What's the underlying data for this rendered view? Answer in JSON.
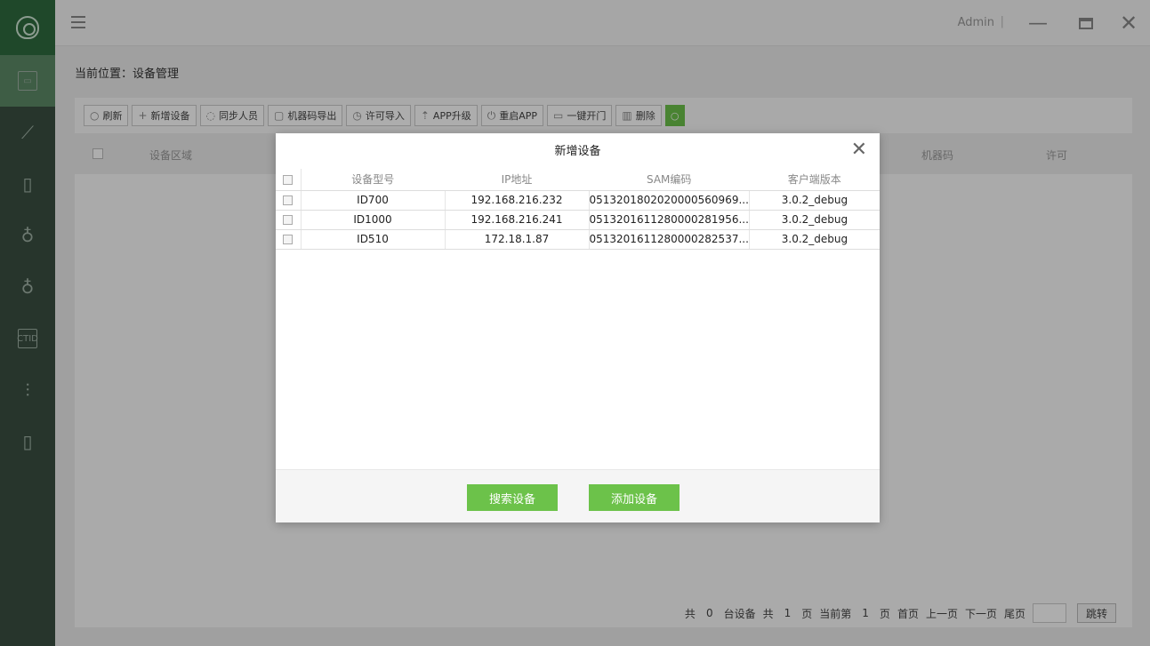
{
  "topbar": {
    "user": "Admin",
    "separator": "|"
  },
  "breadcrumb": "当前位置：设备管理",
  "toolbar": {
    "refresh": "刷新",
    "add_device": "新增设备",
    "sync_people": "同步人员",
    "export_machine_code": "机器码导出",
    "import_license": "许可导入",
    "app_upgrade": "APP升级",
    "restart_app": "重启APP",
    "one_key_open": "一键开门",
    "delete": "删除"
  },
  "main_table": {
    "columns": [
      "设备区域",
      "机器码",
      "许可"
    ]
  },
  "pagination": {
    "total_label": "共",
    "total_count": "0",
    "unit_devices": "台设备",
    "pages_label": "共",
    "pages_count": "1",
    "page_unit": "页",
    "current_label": "当前第",
    "current_page": "1",
    "current_unit": "页",
    "first": "首页",
    "prev": "上一页",
    "next": "下一页",
    "last": "尾页",
    "jump": "跳转"
  },
  "modal": {
    "title": "新增设备",
    "columns": [
      "设备型号",
      "IP地址",
      "SAM编码",
      "客户端版本"
    ],
    "rows": [
      {
        "model": "ID700",
        "ip": "192.168.216.232",
        "sam": "0513201802020000560969...",
        "version": "3.0.2_debug"
      },
      {
        "model": "ID1000",
        "ip": "192.168.216.241",
        "sam": "0513201611280000281956...",
        "version": "3.0.2_debug"
      },
      {
        "model": "ID510",
        "ip": "172.18.1.87",
        "sam": "0513201611280000282537...",
        "version": "3.0.2_debug"
      }
    ],
    "search_button": "搜索设备",
    "add_button": "添加设备"
  },
  "sidebar": {
    "items": [
      "shield-logo",
      "monitor-icon",
      "chart-icon",
      "building-icon",
      "people-icon",
      "people-minus-icon",
      "ctid-icon",
      "sliders-icon",
      "building-icon"
    ]
  },
  "colors": {
    "accent": "#6cc24a",
    "sidebar": "#3a4f42"
  }
}
